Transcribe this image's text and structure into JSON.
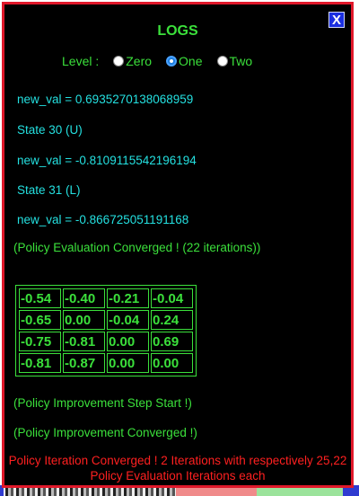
{
  "modal": {
    "title": "LOGS",
    "close_label": "X",
    "level_label": "Level :",
    "level_options": [
      {
        "label": "Zero",
        "selected": false
      },
      {
        "label": "One",
        "selected": true
      },
      {
        "label": "Two",
        "selected": false
      }
    ]
  },
  "log": {
    "lines": [
      "new_val = 0.6935270138068959",
      "State 30 (U)",
      "new_val = -0.8109115542196194",
      "State 31 (L)",
      "new_val = -0.866725051191168"
    ],
    "eval_converged": "(Policy Evaluation Converged ! (22 iterations))",
    "value_grid": [
      [
        "-0.54",
        "-0.40",
        "-0.21",
        "-0.04"
      ],
      [
        "-0.65",
        "0.00",
        "-0.04",
        "0.24"
      ],
      [
        "-0.75",
        "-0.81",
        "0.00",
        "0.69"
      ],
      [
        "-0.81",
        "-0.87",
        "0.00",
        "0.00"
      ]
    ],
    "improvement_start": "(Policy Improvement Step Start !)",
    "improvement_converged": "(Policy Improvement Converged !)",
    "final_message": "Policy Iteration Converged ! 2 Iterations with respectively 25,22 Policy Evaluation Iterations each"
  },
  "colors": {
    "background": "#000000",
    "border": "#e0182a",
    "green_text": "#3be03b",
    "cyan_text": "#24e0e0",
    "red_text": "#ff2020",
    "close_button": "#1b2fe0"
  }
}
